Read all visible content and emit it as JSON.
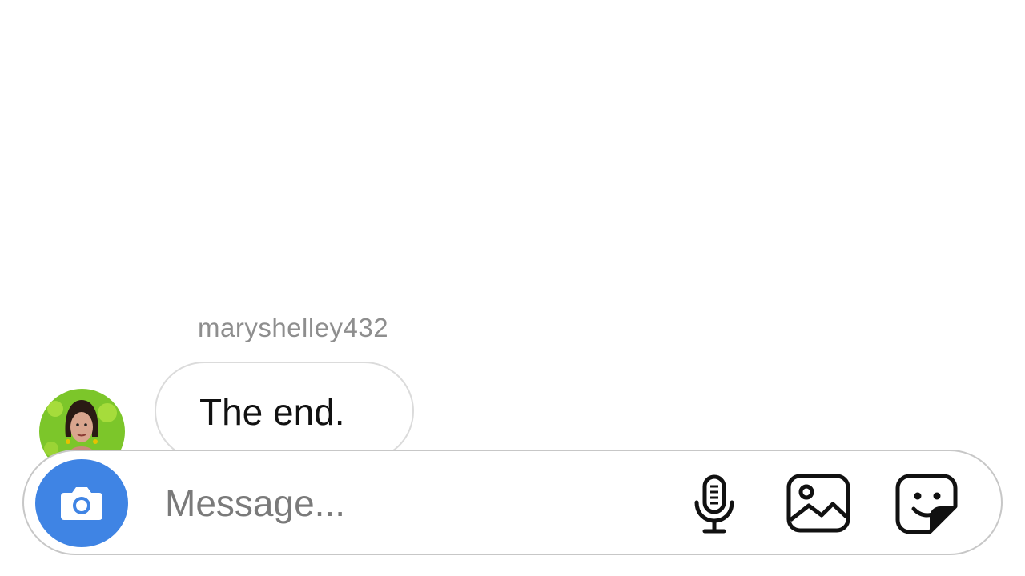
{
  "thread": {
    "sender_username": "maryshelley432",
    "messages": [
      {
        "text": "The end."
      }
    ]
  },
  "composer": {
    "placeholder": "Message...",
    "icons": {
      "camera": "camera-icon",
      "microphone": "microphone-icon",
      "gallery": "gallery-icon",
      "sticker": "sticker-icon"
    }
  },
  "colors": {
    "camera_button": "#3f84e4",
    "username": "#8e8e8e",
    "bubble_border": "#dbdbdb",
    "composer_border": "#c7c7c7"
  }
}
